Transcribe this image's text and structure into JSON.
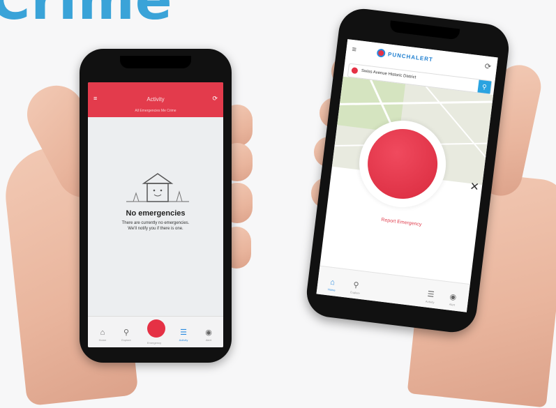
{
  "headline": "Crime",
  "left_phone": {
    "header_title": "Activity",
    "tabs_text": "All Emergencies   Me   Crime",
    "empty_title": "No emergencies",
    "empty_line1": "There are currently no emergencies.",
    "empty_line2": "We'll notify you if there is one.",
    "nav": [
      "Home",
      "Explore",
      "Emergency",
      "Activity",
      "Alert"
    ]
  },
  "right_phone": {
    "logo_text": "PUNCHALERT",
    "search_text": "Swiss Avenue Historic District",
    "report_label": "Report Emergency",
    "close_label": "✕",
    "nav": [
      "Home",
      "Explore",
      "Activity",
      "Alert"
    ]
  },
  "colors": {
    "headline": "#3aa3d8",
    "brand_red": "#e53145",
    "brand_blue": "#2a8be0"
  }
}
